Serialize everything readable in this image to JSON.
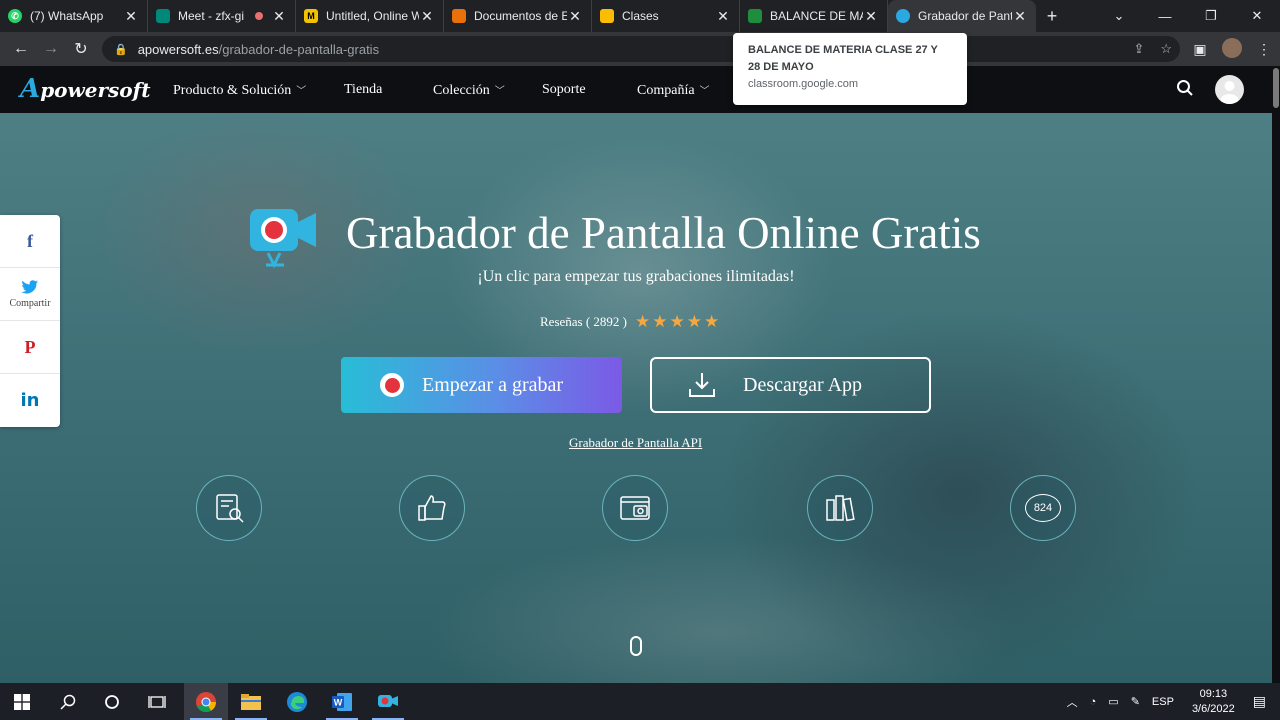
{
  "browser": {
    "tabs": [
      {
        "title": "(7) WhatsApp",
        "icon": "whatsapp-icon",
        "color": "#25d366",
        "active": false
      },
      {
        "title": "Meet - zfx-gi",
        "icon": "meet-icon",
        "color": "#00897b",
        "active": false,
        "recording": true
      },
      {
        "title": "Untitled, Online W",
        "icon": "miro-icon",
        "color": "#f2c100",
        "active": false
      },
      {
        "title": "Documentos de E",
        "icon": "classroom-icon",
        "color": "#e8710a",
        "active": false
      },
      {
        "title": "Clases",
        "icon": "classroom-icon",
        "color": "#fbbc04",
        "active": false
      },
      {
        "title": "BALANCE DE MA",
        "icon": "classroom-icon",
        "color": "#1e8e3e",
        "active": false
      },
      {
        "title": "Grabador de Pant",
        "icon": "apowersoft-icon",
        "color": "#2aa8e0",
        "active": true
      }
    ],
    "url_host": "apowersoft.es",
    "url_path": "/grabador-de-pantalla-gratis",
    "tooltip": {
      "title": "BALANCE DE MATERIA CLASE 27 Y 28 DE MAYO",
      "url": "classroom.google.com"
    }
  },
  "site": {
    "logo_text": "powersoft",
    "logo_letter": "A",
    "nav": [
      "Producto & Solución",
      "Tienda",
      "Colección",
      "Soporte",
      "Compañía"
    ],
    "hero": {
      "title": "Grabador de Pantalla Online Gratis",
      "subtitle": "¡Un clic para empezar tus grabaciones ilimitadas!",
      "reviews_label": "Reseñas ( 2892 )",
      "rating_stars": 5,
      "record_button": "Empezar a grabar",
      "download_button": "Descargar App",
      "api_link": "Grabador de Pantalla API",
      "feature_badge": "824"
    },
    "share": {
      "label": "Compartir",
      "items": [
        "f",
        "twitter",
        "P",
        "in"
      ]
    },
    "colors": {
      "accent_blue": "#2aa8e0",
      "record_red": "#e5333d",
      "star": "#f7a740"
    }
  },
  "taskbar": {
    "lang": "ESP",
    "time": "09:13",
    "date": "3/6/2022"
  }
}
